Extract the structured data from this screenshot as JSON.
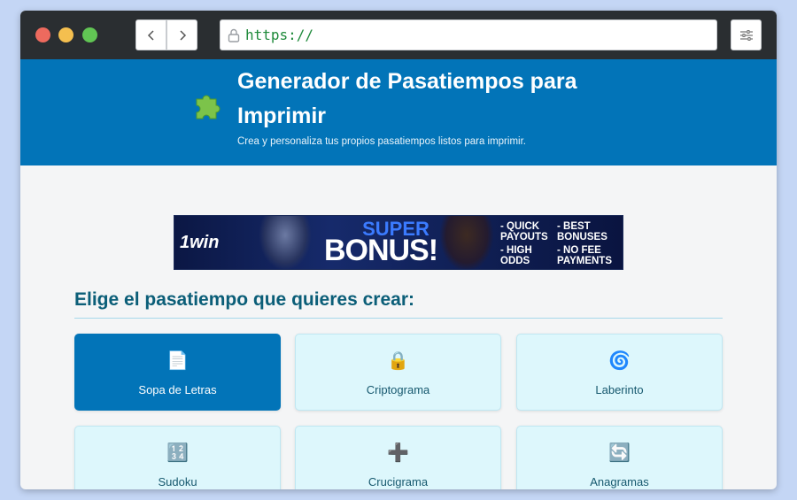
{
  "browser": {
    "url": "https://",
    "icons": {
      "back": "chevron-left-icon",
      "forward": "chevron-right-icon",
      "lock": "lock-icon",
      "menu": "sliders-icon"
    }
  },
  "header": {
    "logo_icon": "puzzle-piece-icon",
    "title": "Generador de Pasatiempos para Imprimir",
    "subtitle": "Crea y personaliza tus propios pasatiempos listos para imprimir."
  },
  "ad": {
    "brand": "1win",
    "headline_top": "SUPER",
    "headline_bottom": "BONUS!",
    "features": [
      "- QUICK PAYOUTS",
      "- BEST BONUSES",
      "- HIGH ODDS",
      "- NO FEE PAYMENTS"
    ]
  },
  "section": {
    "title": "Elige el pasatiempo que quieres crear:"
  },
  "cards": [
    {
      "label": "Sopa de Letras",
      "icon": "document-icon",
      "glyph": "📄",
      "active": true
    },
    {
      "label": "Criptograma",
      "icon": "lock-icon",
      "glyph": "🔒",
      "active": false
    },
    {
      "label": "Laberinto",
      "icon": "spiral-icon",
      "glyph": "🌀",
      "active": false
    },
    {
      "label": "Sudoku",
      "icon": "numbers-icon",
      "glyph": "🔢",
      "active": false
    },
    {
      "label": "Crucigrama",
      "icon": "plus-icon",
      "glyph": "➕",
      "active": false
    },
    {
      "label": "Anagramas",
      "icon": "refresh-icon",
      "glyph": "🔄",
      "active": false
    }
  ],
  "colors": {
    "primary": "#0274b8",
    "card_bg": "#ddf7fc",
    "title_text": "#0b5e78",
    "page_bg": "#c4d6f5"
  }
}
